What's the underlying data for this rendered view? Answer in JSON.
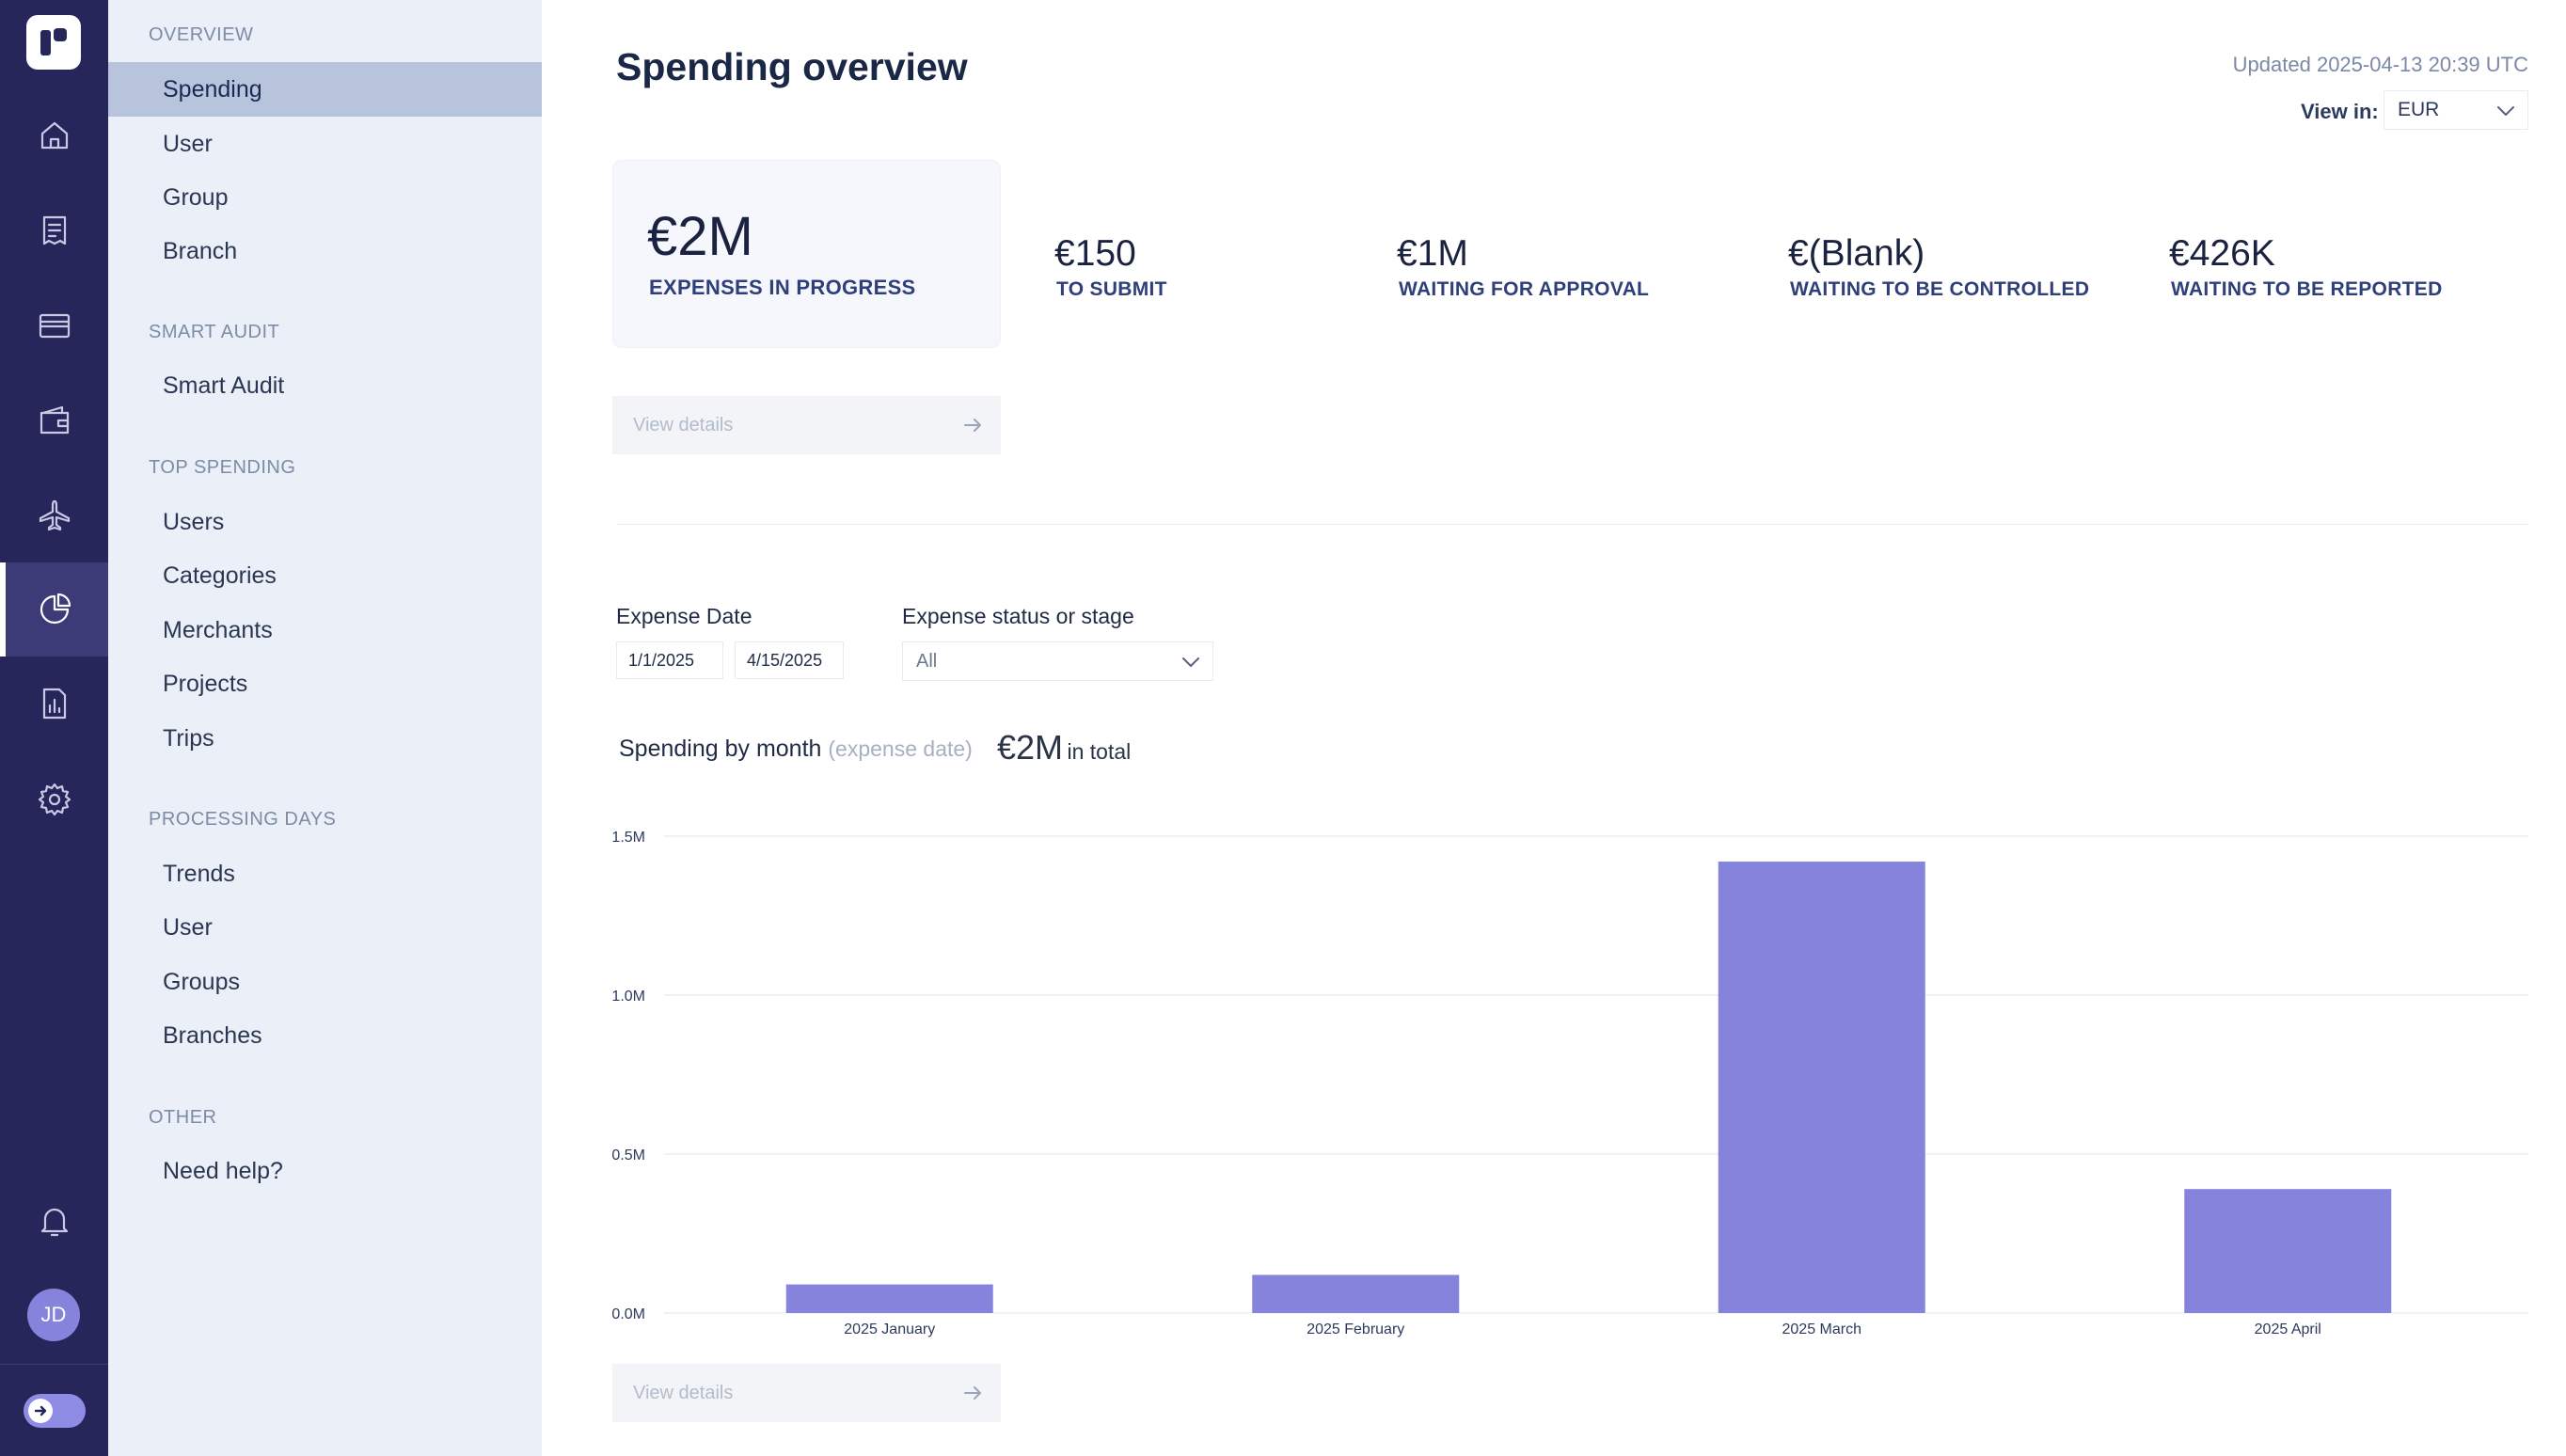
{
  "rail": {
    "items": [
      {
        "name": "home-icon"
      },
      {
        "name": "receipt-icon"
      },
      {
        "name": "card-icon"
      },
      {
        "name": "wallet-icon"
      },
      {
        "name": "airplane-icon"
      },
      {
        "name": "pie-chart-icon",
        "active": true
      },
      {
        "name": "report-icon"
      },
      {
        "name": "gear-icon"
      }
    ],
    "bell_icon": "bell-icon",
    "avatar_initials": "JD"
  },
  "subnav": {
    "sections": [
      {
        "title": "OVERVIEW",
        "items": [
          "Spending",
          "User",
          "Group",
          "Branch"
        ]
      },
      {
        "title": "SMART AUDIT",
        "items": [
          "Smart Audit"
        ]
      },
      {
        "title": "TOP SPENDING",
        "items": [
          "Users",
          "Categories",
          "Merchants",
          "Projects",
          "Trips"
        ]
      },
      {
        "title": "PROCESSING DAYS",
        "items": [
          "Trends",
          "User",
          "Groups",
          "Branches"
        ]
      },
      {
        "title": "OTHER",
        "items": [
          "Need help?"
        ]
      }
    ],
    "active_item": "Spending"
  },
  "header": {
    "title": "Spending overview",
    "updated": "Updated 2025-04-13 20:39 UTC",
    "view_in_label": "View in:",
    "currency": "EUR"
  },
  "kpis": {
    "main": {
      "value": "€2M",
      "label": "EXPENSES IN PROGRESS"
    },
    "items": [
      {
        "value": "€150",
        "label": "TO SUBMIT"
      },
      {
        "value": "€1M",
        "label": "WAITING FOR APPROVAL"
      },
      {
        "value": "€(Blank)",
        "label": "WAITING TO BE CONTROLLED"
      },
      {
        "value": "€426K",
        "label": "WAITING TO BE REPORTED"
      }
    ]
  },
  "view_details": "View details",
  "filters": {
    "date_label": "Expense Date",
    "date_from": "1/1/2025",
    "date_to": "4/15/2025",
    "status_label": "Expense status or stage",
    "status_value": "All"
  },
  "chart_header": {
    "title": "Spending by month",
    "subtitle": "(expense date)",
    "total_value": "€2M",
    "total_suffix": "in total"
  },
  "chart_data": {
    "type": "bar",
    "categories": [
      "2025 January",
      "2025 February",
      "2025 March",
      "2025 April"
    ],
    "values": [
      0.09,
      0.12,
      1.42,
      0.39
    ],
    "ylim": [
      0,
      1.5
    ],
    "yticks": [
      0,
      0.5,
      1.0,
      1.5
    ],
    "ytick_labels": [
      "0.0M",
      "0.5M",
      "1.0M",
      "1.5M"
    ],
    "grid": true,
    "color": "#8683dc"
  }
}
